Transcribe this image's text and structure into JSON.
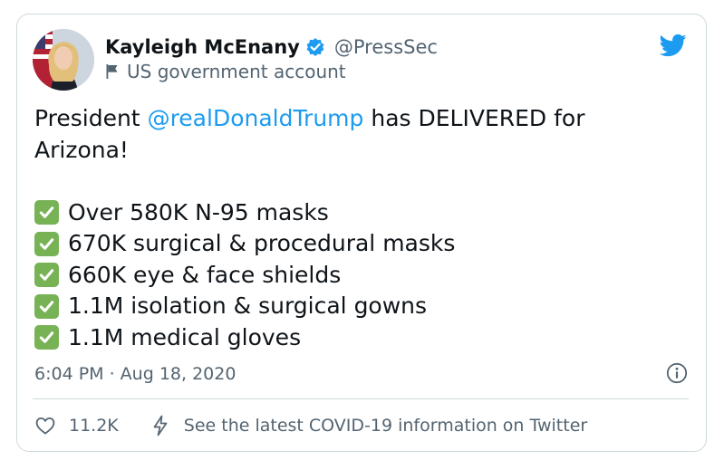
{
  "author": {
    "display_name": "Kayleigh McEnany",
    "handle": "@PressSec",
    "label": "US government account"
  },
  "tweet": {
    "text_before_mention": "President ",
    "mention": "@realDonaldTrump",
    "text_after_mention": " has DELIVERED for",
    "text_line2": "Arizona!",
    "items": [
      "Over 580K N-95 masks",
      "670K surgical & procedural masks",
      "660K eye & face shields",
      "1.1M isolation & surgical gowns",
      "1.1M medical gloves"
    ]
  },
  "meta": {
    "timestamp": "6:04 PM · Aug 18, 2020"
  },
  "actions": {
    "likes": "11.2K",
    "covid_link": "See the latest COVID-19 information on Twitter"
  },
  "icons": {
    "verified": "verified-badge-icon",
    "government": "flag-icon",
    "brand": "twitter-bird-icon",
    "check": "check-mark-icon",
    "info": "info-icon",
    "like": "heart-icon",
    "covid": "lightning-bolt-icon"
  },
  "colors": {
    "brand_blue": "#1d9bf0",
    "check_green": "#77b255",
    "text_primary": "#0f1419",
    "text_secondary": "#536471",
    "border": "#cfd9de"
  }
}
